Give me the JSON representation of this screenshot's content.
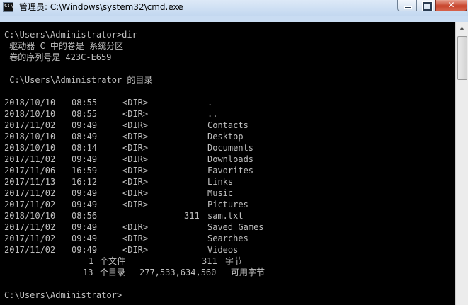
{
  "window": {
    "title": "管理员: C:\\Windows\\system32\\cmd.exe",
    "icon_text": "C:\\",
    "minimize": "minimize",
    "maximize": "maximize",
    "close": "close"
  },
  "console": {
    "prompt_command": "C:\\Users\\Administrator>dir",
    "volume_line": " 驱动器 C 中的卷是 系统分区",
    "serial_line": " 卷的序列号是 423C-E659",
    "dir_header": " C:\\Users\\Administrator 的目录",
    "entries": [
      {
        "date": "2018/10/10",
        "time": "08:55",
        "type": "<DIR>",
        "size": "",
        "name": "."
      },
      {
        "date": "2018/10/10",
        "time": "08:55",
        "type": "<DIR>",
        "size": "",
        "name": ".."
      },
      {
        "date": "2017/11/02",
        "time": "09:49",
        "type": "<DIR>",
        "size": "",
        "name": "Contacts"
      },
      {
        "date": "2018/10/10",
        "time": "08:49",
        "type": "<DIR>",
        "size": "",
        "name": "Desktop"
      },
      {
        "date": "2018/10/10",
        "time": "08:14",
        "type": "<DIR>",
        "size": "",
        "name": "Documents"
      },
      {
        "date": "2017/11/02",
        "time": "09:49",
        "type": "<DIR>",
        "size": "",
        "name": "Downloads"
      },
      {
        "date": "2017/11/06",
        "time": "16:59",
        "type": "<DIR>",
        "size": "",
        "name": "Favorites"
      },
      {
        "date": "2017/11/13",
        "time": "16:12",
        "type": "<DIR>",
        "size": "",
        "name": "Links"
      },
      {
        "date": "2017/11/02",
        "time": "09:49",
        "type": "<DIR>",
        "size": "",
        "name": "Music"
      },
      {
        "date": "2017/11/02",
        "time": "09:49",
        "type": "<DIR>",
        "size": "",
        "name": "Pictures"
      },
      {
        "date": "2018/10/10",
        "time": "08:56",
        "type": "",
        "size": "311",
        "name": "sam.txt"
      },
      {
        "date": "2017/11/02",
        "time": "09:49",
        "type": "<DIR>",
        "size": "",
        "name": "Saved Games"
      },
      {
        "date": "2017/11/02",
        "time": "09:49",
        "type": "<DIR>",
        "size": "",
        "name": "Searches"
      },
      {
        "date": "2017/11/02",
        "time": "09:49",
        "type": "<DIR>",
        "size": "",
        "name": "Videos"
      }
    ],
    "summary_files_count": "1",
    "summary_files_label": "个文件",
    "summary_files_bytes": "311",
    "summary_bytes_label": "字节",
    "summary_dirs_count": "13",
    "summary_dirs_label": "个目录",
    "summary_free_bytes": "277,533,634,560",
    "summary_free_label": "可用字节",
    "final_prompt": "C:\\Users\\Administrator>"
  }
}
